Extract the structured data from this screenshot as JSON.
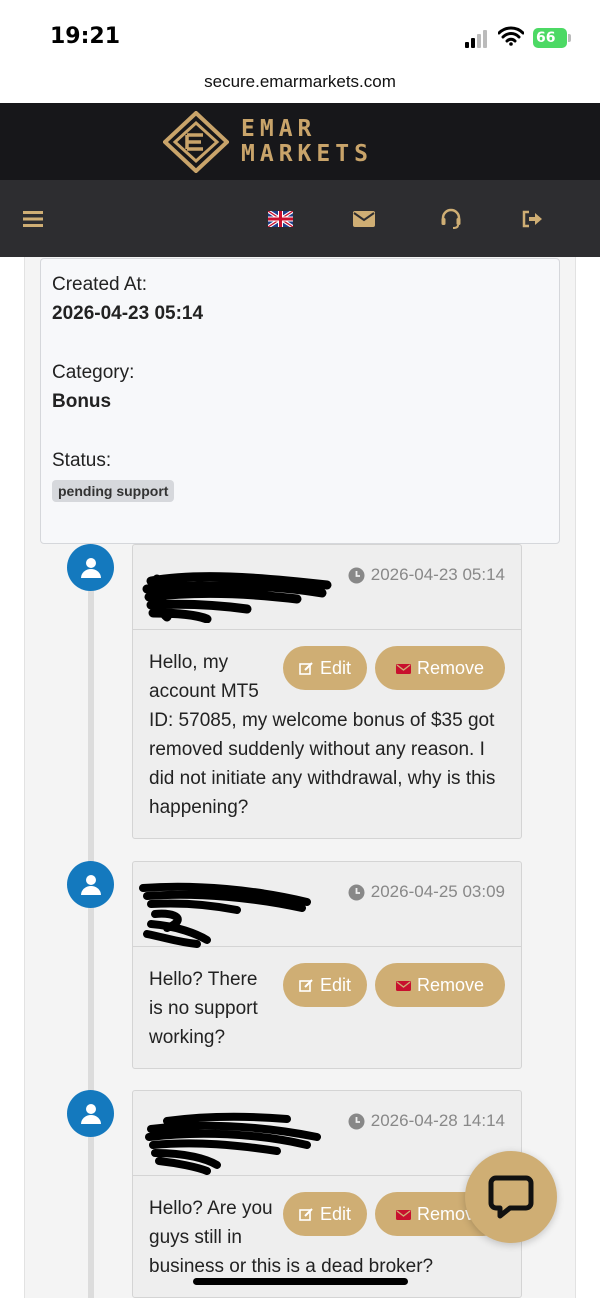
{
  "status_bar": {
    "time": "19:21",
    "battery": "66"
  },
  "browser": {
    "url": "secure.emarmarkets.com"
  },
  "brand": {
    "line1": "EMAR",
    "line2": "MARKETS",
    "color": "#c9a46a"
  },
  "nav": {
    "icons": [
      "menu-icon",
      "uk-flag-icon",
      "envelope-icon",
      "headset-icon",
      "sign-out-icon"
    ]
  },
  "ticket": {
    "created_label": "Created At:",
    "created_value": "2026-04-23 05:14",
    "category_label": "Category:",
    "category_value": "Bonus",
    "status_label": "Status:",
    "status_value": "pending support"
  },
  "messages": [
    {
      "author": "",
      "time": "2026-04-23 05:14",
      "text": "Hello, my account MT5 ID: 57085, my welcome bonus of $35 got removed suddenly without any reason. I did not initiate any withdrawal, why is this happening?",
      "edit_label": "Edit",
      "remove_label": "Remove"
    },
    {
      "author": "",
      "time": "2026-04-25 03:09",
      "text": "Hello? There is no support working?",
      "edit_label": "Edit",
      "remove_label": "Remove"
    },
    {
      "author": "",
      "time": "2026-04-28 14:14",
      "text": "Hello? Are you guys still in business or this is a dead broker?",
      "edit_label": "Edit",
      "remove_label": "Remove"
    }
  ],
  "colors": {
    "accent": "#cfae74",
    "link": "#1e88c9",
    "avatar": "#1479be",
    "remove_icon": "#c8102e"
  }
}
